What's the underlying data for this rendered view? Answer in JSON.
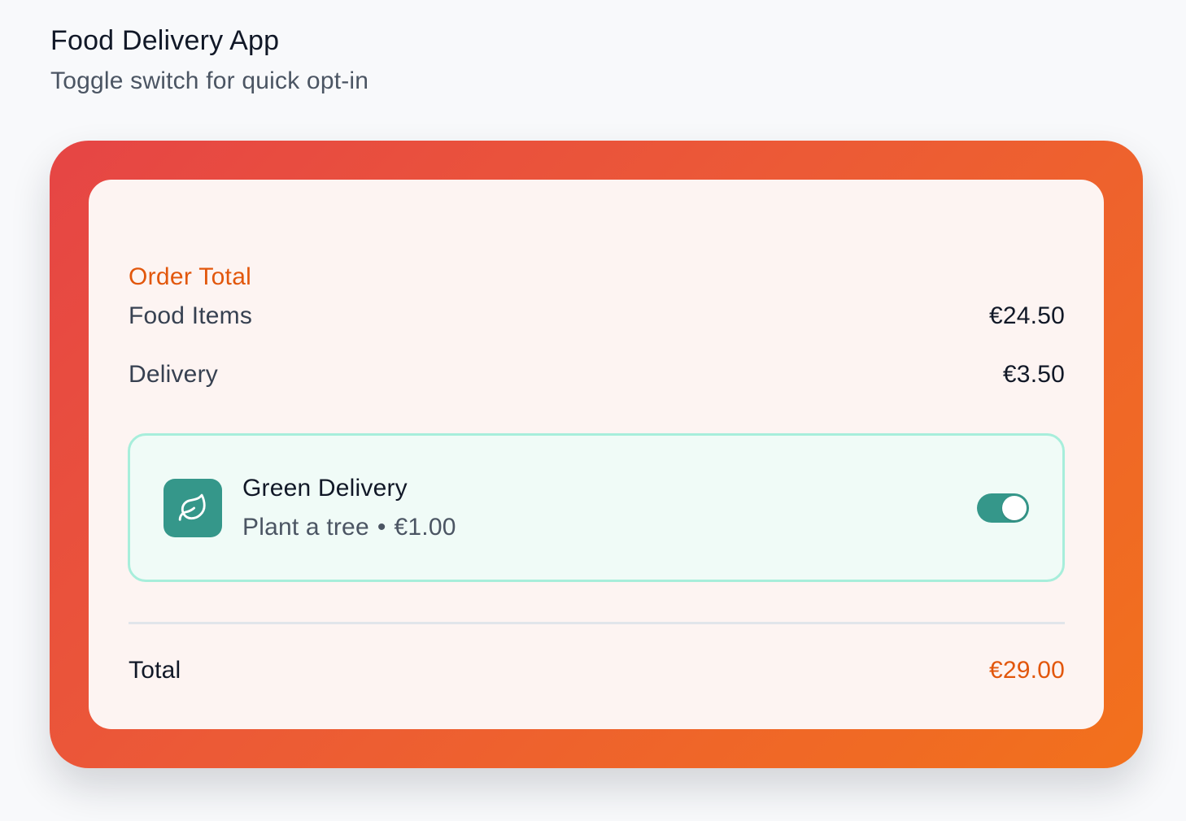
{
  "app": {
    "title": "Food Delivery App",
    "subtitle": "Toggle switch for quick opt-in"
  },
  "order": {
    "section_title": "Order Total",
    "lines": [
      {
        "label": "Food Items",
        "value": "€24.50"
      },
      {
        "label": "Delivery",
        "value": "€3.50"
      }
    ],
    "green_option": {
      "icon": "leaf-icon",
      "title": "Green Delivery",
      "description": "Plant a tree",
      "separator": "•",
      "price": "€1.00",
      "enabled": true
    },
    "total": {
      "label": "Total",
      "value": "€29.00"
    }
  },
  "colors": {
    "accent_orange": "#e2570c",
    "gradient_start": "#e64545",
    "gradient_end": "#f2711c",
    "green_accent": "#35978a",
    "green_bg": "#f0fbf7",
    "green_border": "#a7eedb"
  }
}
